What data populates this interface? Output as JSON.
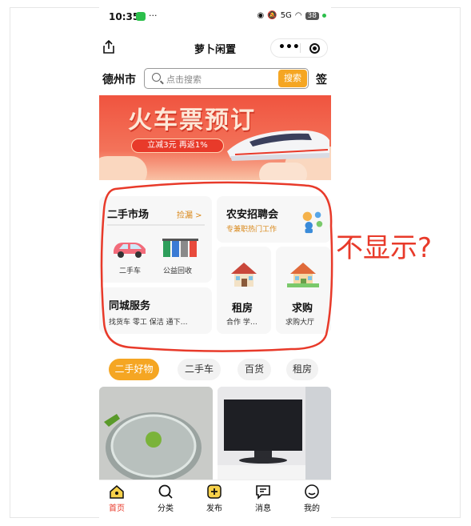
{
  "status_bar": {
    "time": "10:35",
    "dots": "···",
    "battery": "38",
    "signal": "5G"
  },
  "title_bar": {
    "title": "萝卜闲置",
    "more": "•••"
  },
  "search": {
    "city": "德州市",
    "placeholder": "点击搜索",
    "button": "搜索",
    "sign": "签"
  },
  "banner": {
    "title": "火车票预订",
    "promo": "立减3元 再返1%"
  },
  "market": {
    "title": "二手市场",
    "link": "捡漏 >",
    "items": [
      {
        "label": "二手车"
      },
      {
        "label": "公益回收"
      }
    ]
  },
  "city_service": {
    "title": "同城服务",
    "desc": "找货车 零工 保洁 通下…"
  },
  "jobs": {
    "title": "农安招聘会",
    "desc": "专兼职热门工作"
  },
  "rent": {
    "title": "租房",
    "desc": "合作 学…"
  },
  "buy": {
    "title": "求购",
    "desc": "求购大厅"
  },
  "annotation": "不显示?",
  "tabs": [
    {
      "label": "二手好物"
    },
    {
      "label": "二手车"
    },
    {
      "label": "百货"
    },
    {
      "label": "租房"
    }
  ],
  "nav": [
    {
      "label": "首页"
    },
    {
      "label": "分类"
    },
    {
      "label": "发布"
    },
    {
      "label": "消息"
    },
    {
      "label": "我的"
    }
  ],
  "colors": {
    "accent": "#f5a623",
    "banner_red": "#f0543f",
    "annotation_red": "#e83a2a",
    "active_nav": "#e83a2a"
  }
}
